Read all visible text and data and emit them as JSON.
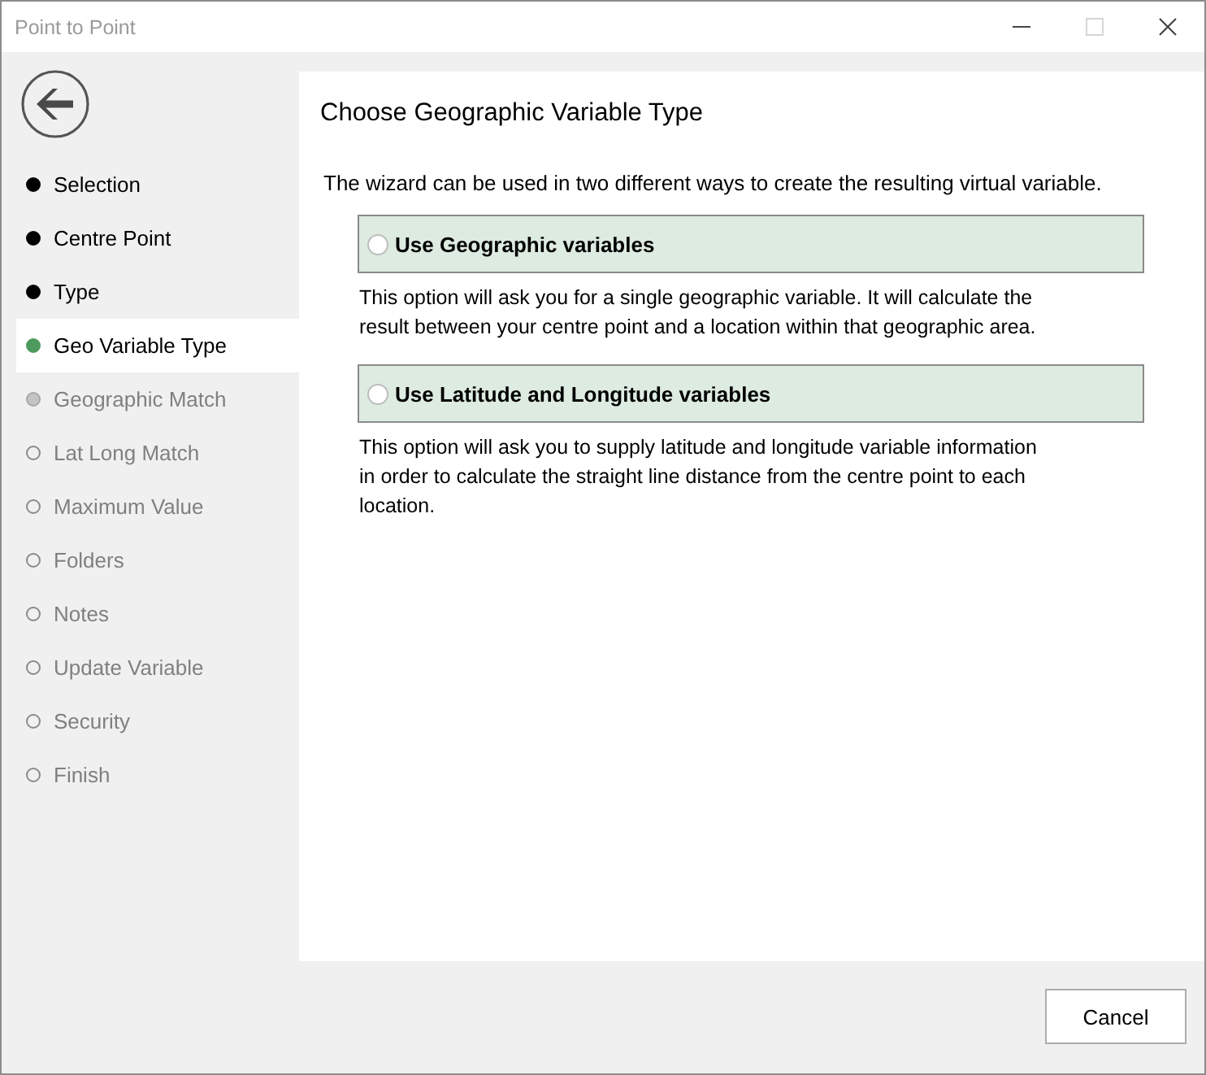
{
  "window": {
    "title": "Point to Point",
    "controls": [
      {
        "kind": "minimize",
        "disabled": false
      },
      {
        "kind": "maximize",
        "disabled": true
      },
      {
        "kind": "close",
        "disabled": false
      }
    ]
  },
  "steps": [
    {
      "label": "Selection",
      "kind": "done",
      "selected": false
    },
    {
      "label": "Centre Point",
      "kind": "done",
      "selected": false
    },
    {
      "label": "Type",
      "kind": "done",
      "selected": false
    },
    {
      "label": "Geo Variable Type",
      "kind": "current",
      "selected": true
    },
    {
      "label": "Geographic Match",
      "kind": "next",
      "selected": false
    },
    {
      "label": "Lat Long Match",
      "kind": "pending",
      "selected": false
    },
    {
      "label": "Maximum Value",
      "kind": "pending",
      "selected": false
    },
    {
      "label": "Folders",
      "kind": "pending",
      "selected": false
    },
    {
      "label": "Notes",
      "kind": "pending",
      "selected": false
    },
    {
      "label": "Update Variable",
      "kind": "pending",
      "selected": false
    },
    {
      "label": "Security",
      "kind": "pending",
      "selected": false
    },
    {
      "label": "Finish",
      "kind": "pending",
      "selected": false
    }
  ],
  "page": {
    "title": "Choose Geographic Variable Type",
    "intro": "The wizard can be used in two different ways to create the resulting virtual variable.",
    "options": [
      {
        "label": "Use Geographic variables",
        "selected": false,
        "description": "This option will ask you for a single geographic variable. It will calculate the result between your centre point and a location within that geographic area."
      },
      {
        "label": "Use Latitude and Longitude variables",
        "selected": false,
        "description": "This option will ask you to supply latitude and longitude variable information in order to calculate the straight line distance from the centre point to each location."
      }
    ]
  },
  "buttons": [
    "Cancel"
  ]
}
